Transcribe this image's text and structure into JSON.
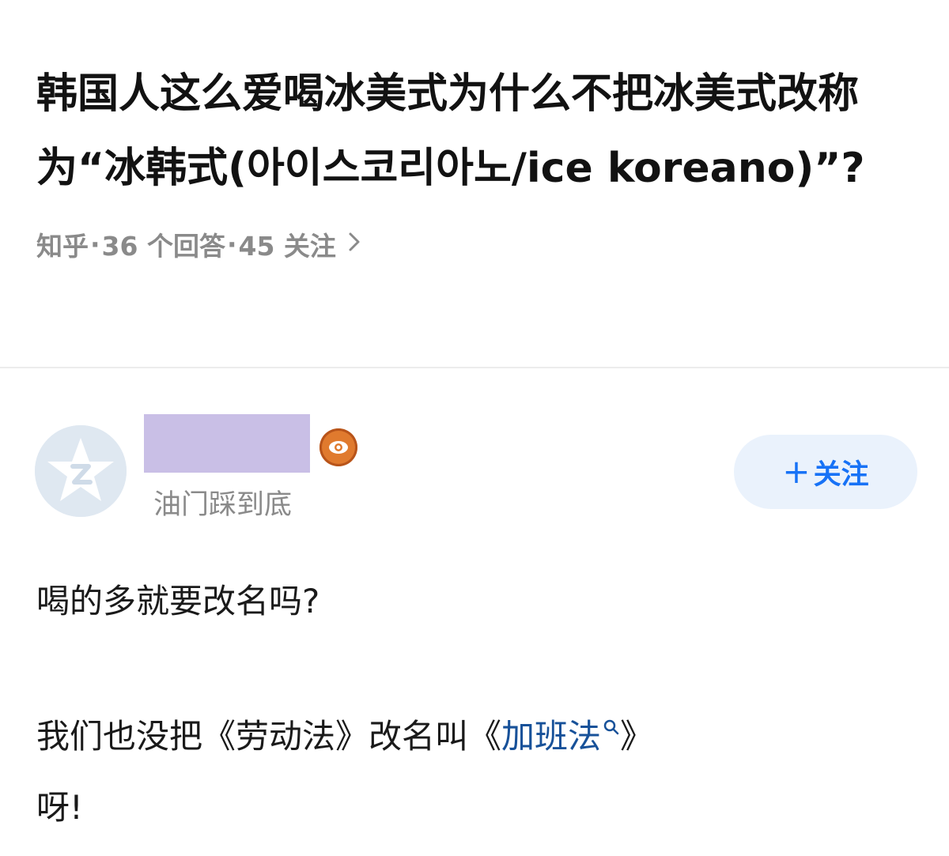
{
  "question": {
    "title": "韩国人这么爱喝冰美式为什么不把冰美式改称为“冰韩式(아이스코리아노/ice koreano)”?",
    "source": "知乎",
    "sep": "·",
    "answers": "36 个回答",
    "followers": "45 关注",
    "chevron_icon": "chevron-right-icon"
  },
  "author": {
    "avatar_icon": "default-avatar-icon",
    "badge_icon": "eye-badge-icon",
    "bio": "油门踩到底",
    "follow_label": "关注",
    "follow_plus": "+"
  },
  "answer": {
    "p1": "喝的多就要改名吗?",
    "p2_before": "我们也没把《劳动法》改名叫《",
    "p2_link": "加班法",
    "p2_after": "》",
    "p3": "呀!",
    "link_color": "#175199"
  },
  "colors": {
    "accent": "#1772f6",
    "muted": "#8a8a8a",
    "follow_bg": "#eaf2fc",
    "name_redaction": "#c9bfe6",
    "badge": "#e07a2e"
  }
}
